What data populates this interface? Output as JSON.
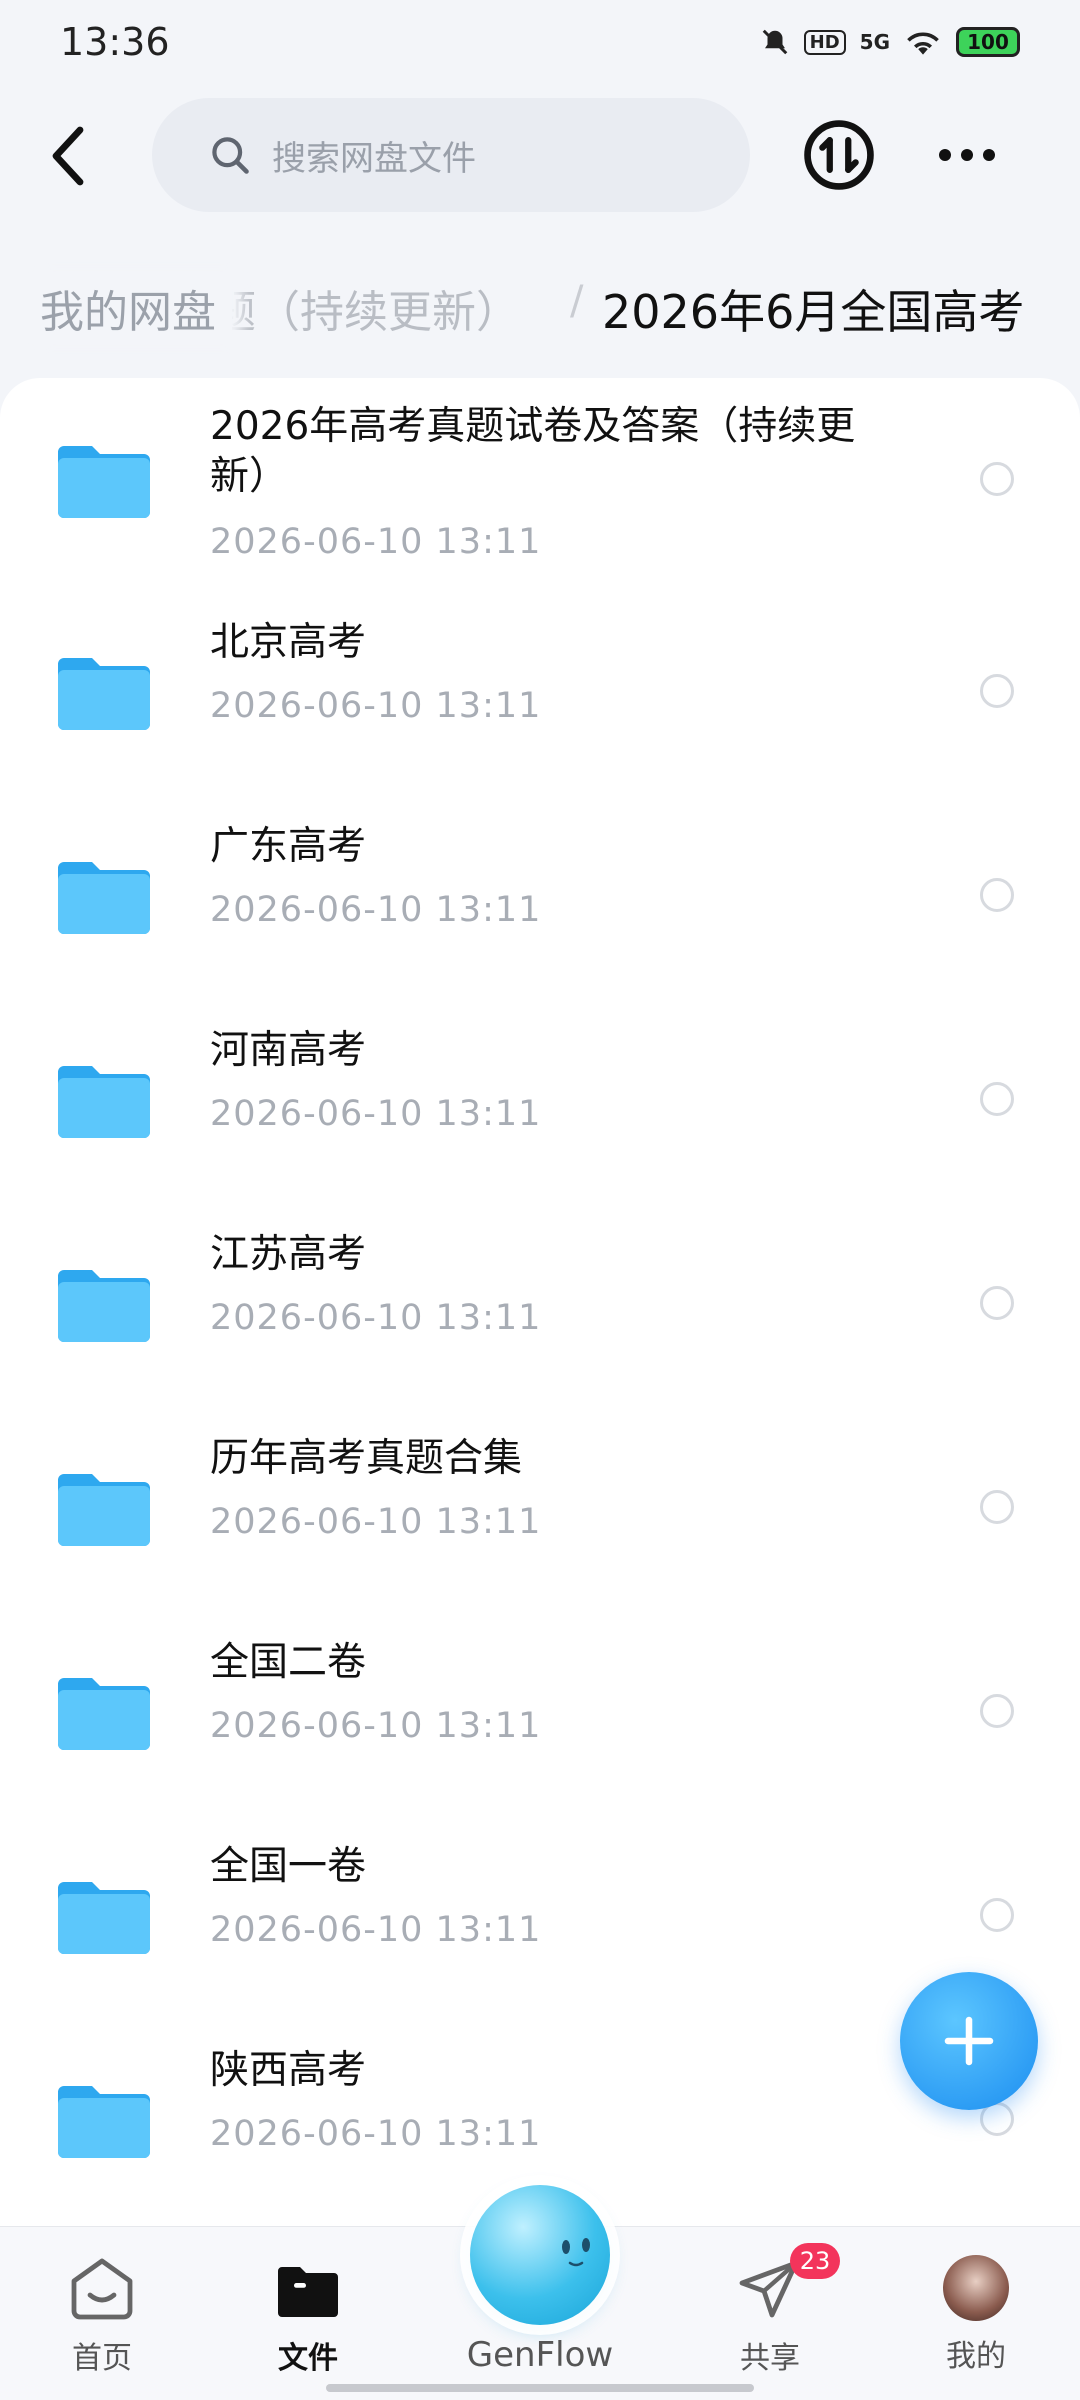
{
  "status_bar": {
    "time": "13:36",
    "network": "5G",
    "hd": "HD",
    "battery": "100"
  },
  "header": {
    "search_placeholder": "搜索网盘文件"
  },
  "breadcrumb": {
    "home": "我的网盘",
    "middle_partial": "题（持续更新）",
    "separator": "/",
    "current": "2026年6月全国高考"
  },
  "files": [
    {
      "name": "2026年高考真题试卷及答案（持续更新）",
      "date": "2026-06-10  13:11"
    },
    {
      "name": "北京高考",
      "date": "2026-06-10  13:11"
    },
    {
      "name": "广东高考",
      "date": "2026-06-10  13:11"
    },
    {
      "name": "河南高考",
      "date": "2026-06-10  13:11"
    },
    {
      "name": "江苏高考",
      "date": "2026-06-10  13:11"
    },
    {
      "name": "历年高考真题合集",
      "date": "2026-06-10  13:11"
    },
    {
      "name": "全国二卷",
      "date": "2026-06-10  13:11"
    },
    {
      "name": "全国一卷",
      "date": "2026-06-10  13:11"
    },
    {
      "name": "陕西高考",
      "date": "2026-06-10  13:11"
    }
  ],
  "bottom_nav": {
    "home": "首页",
    "files": "文件",
    "genflow": "GenFlow",
    "share": "共享",
    "share_badge": "23",
    "me": "我的"
  },
  "colors": {
    "accent": "#1b8df0",
    "folder": "#3ab6f4",
    "badge": "#f3345b"
  }
}
